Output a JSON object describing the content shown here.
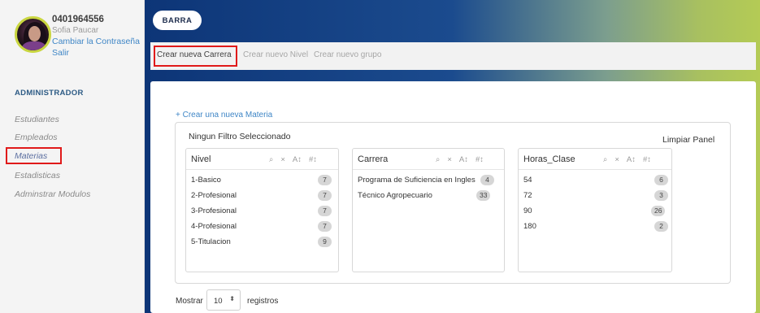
{
  "profile": {
    "id": "0401964556",
    "name": "Sofia Paucar",
    "change_password": "Cambiar la Contraseña",
    "logout": "Salir"
  },
  "sidebar": {
    "section_title": "ADMINISTRADOR",
    "items": [
      {
        "label": "Estudiantes"
      },
      {
        "label": "Empleados"
      },
      {
        "label": "Materias"
      },
      {
        "label": "Estadisticas"
      },
      {
        "label": "Adminstrar Modulos"
      }
    ]
  },
  "header": {
    "barra_label": "BARRA"
  },
  "tabs": [
    {
      "label": "Crear nueva Carrera"
    },
    {
      "label": "Crear nuevo Nivel"
    },
    {
      "label": "Crear nuevo grupo"
    }
  ],
  "main": {
    "new_materia": "+ Crear una nueva Materia",
    "no_filter": "Ningun Filtro Seleccionado",
    "clear_panel": "Limpiar Panel"
  },
  "filters": {
    "nivel": {
      "title": "Nivel",
      "rows": [
        {
          "label": "1-Basico",
          "count": "7"
        },
        {
          "label": "2-Profesional",
          "count": "7"
        },
        {
          "label": "3-Profesional",
          "count": "7"
        },
        {
          "label": "4-Profesional",
          "count": "7"
        },
        {
          "label": "5-Titulacion",
          "count": "9"
        }
      ]
    },
    "carrera": {
      "title": "Carrera",
      "rows": [
        {
          "label": "Programa de Suficiencia en Ingles",
          "count": "4"
        },
        {
          "label": "Técnico Agropecuario",
          "count": "33"
        }
      ]
    },
    "horas": {
      "title": "Horas_Clase",
      "rows": [
        {
          "label": "54",
          "count": "6"
        },
        {
          "label": "72",
          "count": "3"
        },
        {
          "label": "90",
          "count": "26"
        },
        {
          "label": "180",
          "count": "2"
        }
      ]
    },
    "tools": {
      "search": "⌕",
      "clear": "×",
      "sort_alpha": "A↕",
      "sort_num": "#↕"
    }
  },
  "pagination": {
    "show_label": "Mostrar",
    "value": "10",
    "arrow": "⬍",
    "records_label": "registros"
  },
  "colors": {
    "highlight": "#e01a1a",
    "link": "#3f86c6",
    "header_dark": "#0d3577",
    "header_light": "#b4cb55"
  }
}
